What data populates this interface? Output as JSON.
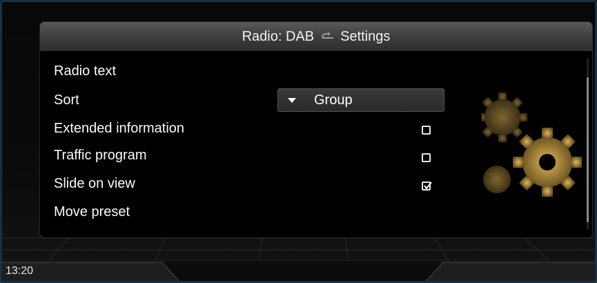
{
  "header": {
    "source": "Radio: DAB",
    "title": "Settings",
    "back_icon": "return-arrow-icon"
  },
  "menu": {
    "items": [
      {
        "label": "Radio text"
      },
      {
        "label": "Sort",
        "value": "Group",
        "control": "dropdown"
      },
      {
        "label": "Extended information",
        "control": "checkbox",
        "checked": false
      },
      {
        "label": "Traffic program",
        "control": "checkbox",
        "checked": false
      },
      {
        "label": "Slide on view",
        "control": "checkbox",
        "checked": true
      },
      {
        "label": "Move preset"
      }
    ]
  },
  "status": {
    "time": "13:20"
  },
  "decoration": {
    "icon": "gears-icon",
    "color": "#c9a24a"
  },
  "colors": {
    "frame": "#12324a",
    "header": "#4a4a4a",
    "accent_gear": "#c9a24a"
  }
}
